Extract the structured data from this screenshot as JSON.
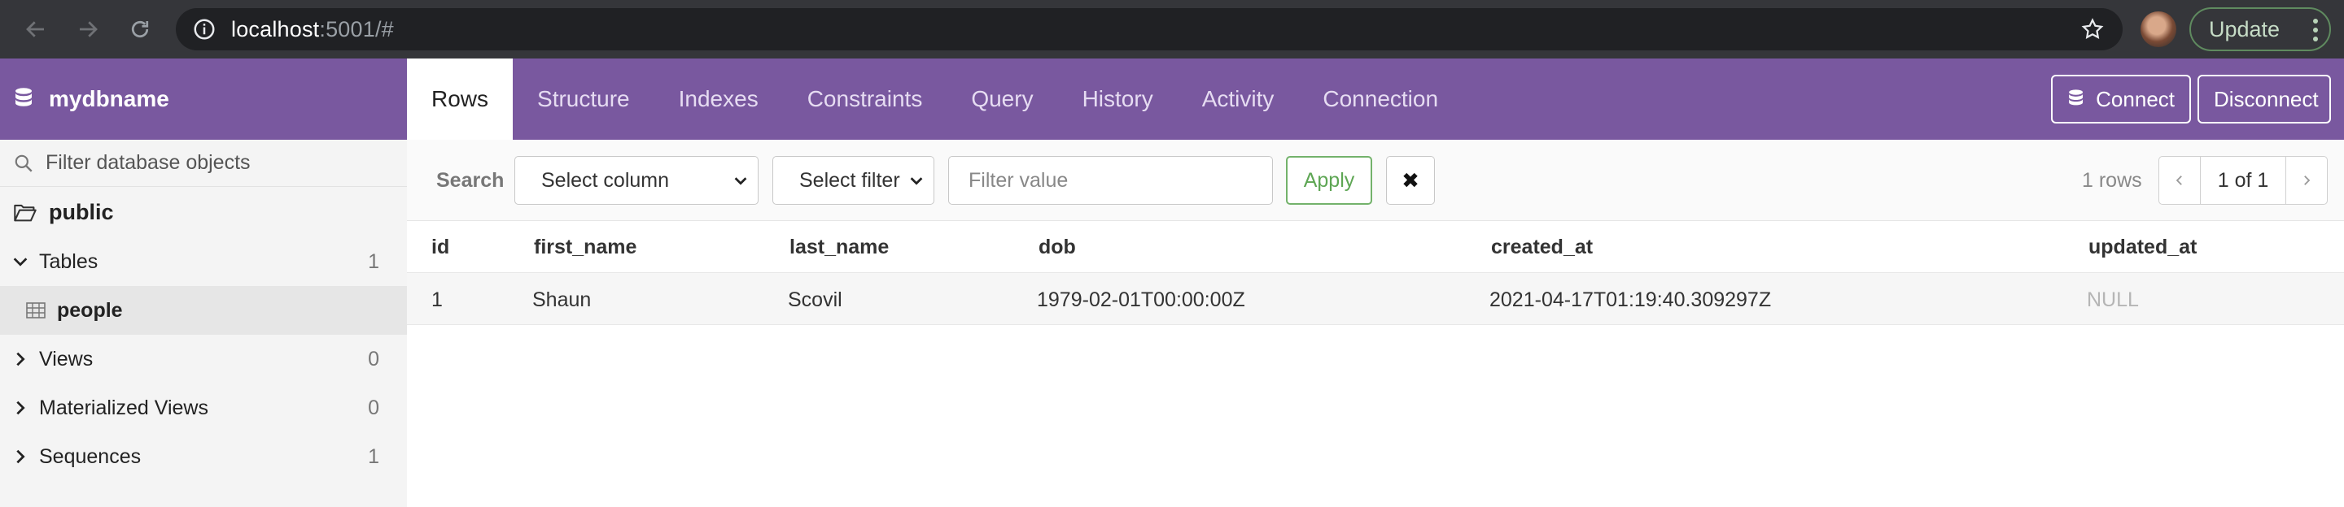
{
  "browser": {
    "url_host": "localhost",
    "url_rest": ":5001/#",
    "update_label": "Update"
  },
  "app": {
    "db_name": "mydbname",
    "tabs": [
      "Rows",
      "Structure",
      "Indexes",
      "Constraints",
      "Query",
      "History",
      "Activity",
      "Connection"
    ],
    "active_tab": "Rows",
    "connect_label": "Connect",
    "disconnect_label": "Disconnect",
    "accent_color": "#79589f"
  },
  "sidebar": {
    "filter_placeholder": "Filter database objects",
    "schema": "public",
    "groups": [
      {
        "label": "Tables",
        "count": "1",
        "expanded": true
      },
      {
        "label": "Views",
        "count": "0",
        "expanded": false
      },
      {
        "label": "Materialized Views",
        "count": "0",
        "expanded": false
      },
      {
        "label": "Sequences",
        "count": "1",
        "expanded": false
      }
    ],
    "tables": [
      "people"
    ]
  },
  "toolbar": {
    "search_label": "Search",
    "column_select": "Select column",
    "filter_select": "Select filter",
    "filter_placeholder": "Filter value",
    "apply_label": "Apply",
    "clear_glyph": "✖",
    "row_count": "1 rows",
    "page": "1 of 1"
  },
  "grid": {
    "columns": [
      "id",
      "first_name",
      "last_name",
      "dob",
      "created_at",
      "updated_at"
    ],
    "rows": [
      [
        "1",
        "Shaun",
        "Scovil",
        "1979-02-01T00:00:00Z",
        "2021-04-17T01:19:40.309297Z",
        "NULL"
      ]
    ]
  }
}
